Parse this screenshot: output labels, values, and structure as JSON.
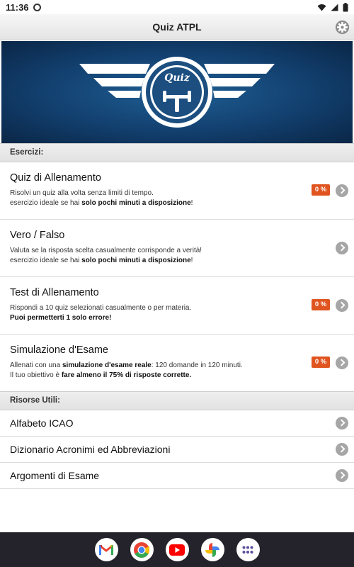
{
  "status_bar": {
    "time": "11:36"
  },
  "app_bar": {
    "title": "Quiz ATPL"
  },
  "banner": {
    "logo_text": "Quiz"
  },
  "sections": {
    "exercises": "Esercizi:",
    "resources": "Risorse Utili:"
  },
  "exercises": [
    {
      "title": "Quiz di Allenamento",
      "desc1_a": "Risolvi un quiz alla volta senza limiti di tempo.",
      "desc2_a": "esercizio ideale se hai ",
      "desc2_b": "solo pochi minuti a disposizione",
      "desc2_c": "!",
      "badge": "0 %"
    },
    {
      "title": "Vero / Falso",
      "desc1_a": "Valuta se la risposta scelta casualmente corrisponde a verità!",
      "desc2_a": "esercizio ideale se hai ",
      "desc2_b": "solo pochi minuti a disposizione",
      "desc2_c": "!"
    },
    {
      "title": "Test di Allenamento",
      "desc1_a": "Rispondi a 10 quiz selezionati casualmente o per materia.",
      "desc2_b": "Puoi permetterti 1 solo errore!",
      "badge": "0 %"
    },
    {
      "title": "Simulazione d'Esame",
      "desc1_a": "Allenati con una ",
      "desc1_b": "simulazione d'esame reale",
      "desc1_c": ": 120 domande in 120 minuti.",
      "desc2_a": "Il tuo obiettivo è ",
      "desc2_b": "fare almeno il 75% di risposte corrette.",
      "badge": "0 %"
    }
  ],
  "resources": [
    {
      "title": "Alfabeto ICAO"
    },
    {
      "title": "Dizionario Acronimi ed Abbreviazioni"
    },
    {
      "title": "Argomenti di Esame"
    }
  ],
  "dock_apps": [
    "gmail-icon",
    "chrome-icon",
    "youtube-icon",
    "photos-icon",
    "app-drawer-icon"
  ]
}
